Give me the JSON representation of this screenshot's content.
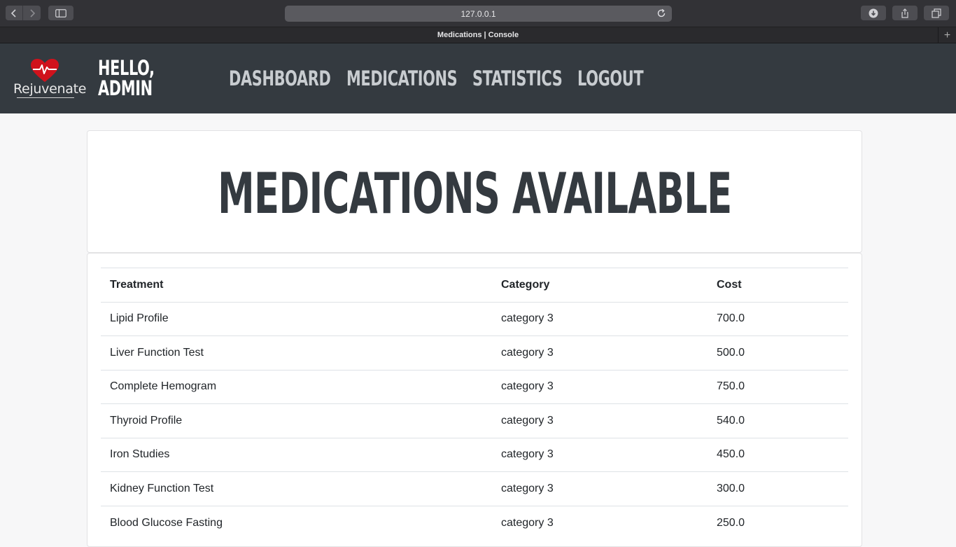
{
  "browser": {
    "url": "127.0.0.1",
    "tab_title": "Medications | Console",
    "new_tab_label": "+"
  },
  "site": {
    "logo_text": "Rejuvenate",
    "nav": [
      {
        "label": "Hello, Admin",
        "active": true
      },
      {
        "label": "Dashboard",
        "active": false
      },
      {
        "label": "Medications",
        "active": false
      },
      {
        "label": "Statistics",
        "active": false
      },
      {
        "label": "Logout",
        "active": false
      }
    ]
  },
  "page": {
    "title": "Medications Available"
  },
  "table": {
    "headers": [
      "Treatment",
      "Category",
      "Cost"
    ],
    "rows": [
      [
        "Lipid Profile",
        "category 3",
        "700.0"
      ],
      [
        "Liver Function Test",
        "category 3",
        "500.0"
      ],
      [
        "Complete Hemogram",
        "category 3",
        "750.0"
      ],
      [
        "Thyroid Profile",
        "category 3",
        "540.0"
      ],
      [
        "Iron Studies",
        "category 3",
        "450.0"
      ],
      [
        "Kidney Function Test",
        "category 3",
        "300.0"
      ],
      [
        "Blood Glucose Fasting",
        "category 3",
        "250.0"
      ]
    ]
  },
  "colors": {
    "navbar": "#343a40",
    "logo_heart": "#d0121c"
  }
}
